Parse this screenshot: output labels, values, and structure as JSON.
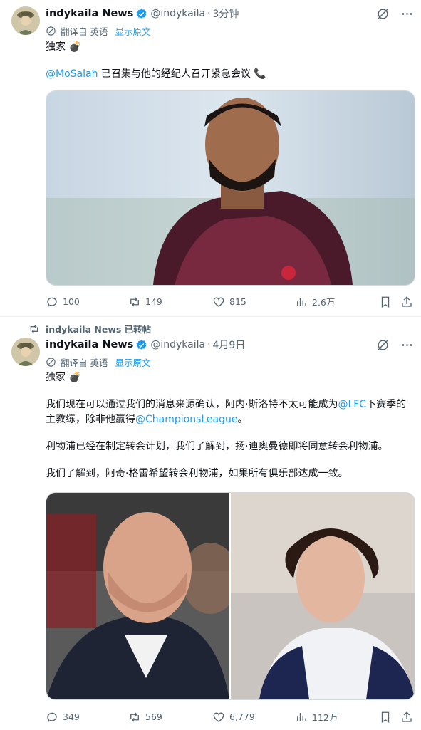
{
  "tweet1": {
    "name": "indykaila News",
    "handle": "@indykaila",
    "dot": "·",
    "time": "3分钟",
    "translated_from": "翻译自 英语",
    "show_original": "显示原文",
    "line1": "独家",
    "mention": "@MoSalah",
    "line2_rest": " 已召集与他的经纪人召开紧急会议",
    "replies": "100",
    "reposts": "149",
    "likes": "815",
    "views": "2.6万"
  },
  "repost_banner": "indykaila News 已转帖",
  "tweet2": {
    "name": "indykaila News",
    "handle": "@indykaila",
    "dot": "·",
    "time": "4月9日",
    "translated_from": "翻译自 英语",
    "show_original": "显示原文",
    "line1": "独家",
    "p1_a": "我们现在可以通过我们的消息来源确认，阿内·斯洛特不太可能成为",
    "p1_mention1": "@LFC",
    "p1_b": "下赛季的主教练，除非他赢得",
    "p1_mention2": "@ChampionsLeague",
    "p1_c": "。",
    "p2": "利物浦已经在制定转会计划，我们了解到，扬·迪奥曼德即将同意转会利物浦。",
    "p3": "我们了解到，阿奇·格雷希望转会利物浦，如果所有俱乐部达成一致。",
    "replies": "349",
    "reposts": "569",
    "likes": "6,779",
    "views": "112万"
  },
  "icons": [
    "verified-badge-icon",
    "grok-slash-icon",
    "more-icon",
    "translate-icon",
    "bomb-icon",
    "phone-icon",
    "reply-icon",
    "repost-icon",
    "like-icon",
    "views-icon",
    "bookmark-icon",
    "share-icon"
  ],
  "colors": {
    "accent": "#1d9bf0",
    "muted": "#536471",
    "text": "#0f1419"
  }
}
